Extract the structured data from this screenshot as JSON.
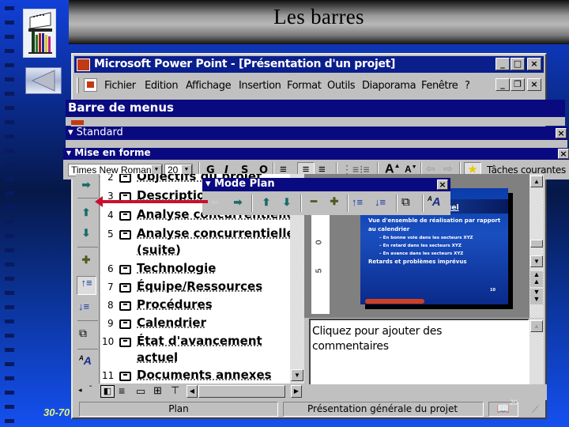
{
  "slide": {
    "title": "Les barres",
    "page_number": "30-70"
  },
  "window": {
    "title": "Microsoft Power Point - [Présentation d'un projet]",
    "controls": {
      "minimize": "_",
      "maximize": "□",
      "close": "×",
      "restore": "❐"
    }
  },
  "menubar": {
    "items": [
      "Fichier",
      "Edition",
      "Affichage",
      "Insertion",
      "Format",
      "Outils",
      "Diaporama",
      "Fenêtre",
      "?"
    ]
  },
  "toolbars": {
    "menus_label": "Barre de menus",
    "standard_label": "Standard",
    "formatting_label": "Mise en forme",
    "outline_label": "Mode Plan",
    "font_name": "Times New Roman",
    "font_size": "20",
    "bold": "G",
    "italic": "I",
    "underline": "S",
    "shadow": "O",
    "common_tasks": "Tâches courantes"
  },
  "outline": {
    "items": [
      {
        "num": "2",
        "text": "Objectifs du projet"
      },
      {
        "num": "3",
        "text": "Description"
      },
      {
        "num": "4",
        "text": "Analyse concurrentielle"
      },
      {
        "num": "5",
        "text": "Analyse concurrentielle",
        "cont": "(suite)"
      },
      {
        "num": "6",
        "text": "Technologie"
      },
      {
        "num": "7",
        "text": "Équipe/Ressources"
      },
      {
        "num": "8",
        "text": "Procédures"
      },
      {
        "num": "9",
        "text": "Calendrier"
      },
      {
        "num": "10",
        "text": "État d'avancement",
        "cont": "actuel"
      },
      {
        "num": "11",
        "text": "Documents annexes"
      }
    ]
  },
  "slide_preview": {
    "heading_fragment": "uel",
    "bullets": [
      "Vue d'ensemble de réalisation par rapport au calendrier",
      "– En bonne voie dans les secteurs XYZ",
      "– En retard dans les secteurs XYZ",
      "– En avance dans les secteurs XYZ",
      "Retards et problèmes imprévus"
    ],
    "footer_num": "10"
  },
  "ruler": {
    "labels": [
      "0",
      "5"
    ]
  },
  "notes": {
    "placeholder": "Cliquez pour ajouter des commentaires"
  },
  "statusbar": {
    "view": "Plan",
    "template": "Présentation générale du projet",
    "spell_badge": "20"
  }
}
